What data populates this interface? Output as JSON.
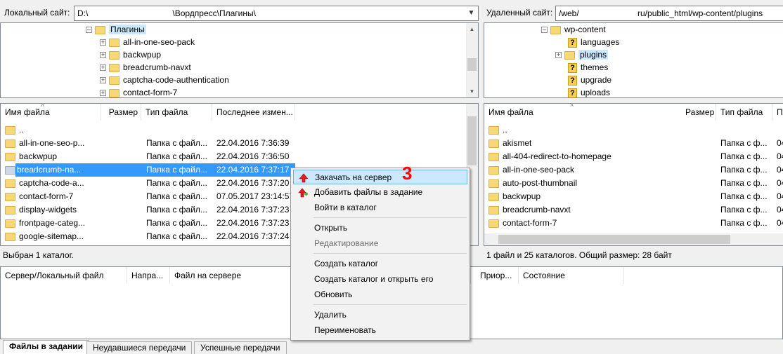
{
  "local": {
    "label": "Локальный сайт:",
    "path": "D:\\                                    \\Вордпресс\\Плагины\\",
    "tree": [
      {
        "label": "Плагины",
        "selected": true
      },
      {
        "label": "all-in-one-seo-pack"
      },
      {
        "label": "backwpup"
      },
      {
        "label": "breadcrumb-navxt"
      },
      {
        "label": "captcha-code-authentication"
      },
      {
        "label": "contact-form-7"
      }
    ],
    "columns": {
      "name": "Имя файла",
      "size": "Размер",
      "type": "Тип файла",
      "modified": "Последнее измен..."
    },
    "rows": [
      {
        "name": "..",
        "type": "",
        "date": ""
      },
      {
        "name": "all-in-one-seo-p...",
        "type": "Папка с файл...",
        "date": "22.04.2016 7:36:39"
      },
      {
        "name": "backwpup",
        "type": "Папка с файл...",
        "date": "22.04.2016 7:36:50"
      },
      {
        "name": "breadcrumb-na...",
        "type": "Папка с файл...",
        "date": "22.04.2016 7:37:17",
        "selected": true
      },
      {
        "name": "captcha-code-a...",
        "type": "Папка с файл...",
        "date": "22.04.2016 7:37:20"
      },
      {
        "name": "contact-form-7",
        "type": "Папка с файл...",
        "date": "07.05.2017 23:14:57"
      },
      {
        "name": "display-widgets",
        "type": "Папка с файл...",
        "date": "22.04.2016 7:37:23"
      },
      {
        "name": "frontpage-categ...",
        "type": "Папка с файл...",
        "date": "22.04.2016 7:37:23"
      },
      {
        "name": "google-sitemap...",
        "type": "Папка с файл...",
        "date": "22.04.2016 7:37:24"
      }
    ],
    "status": "Выбран 1 каталог."
  },
  "remote": {
    "label": "Удаленный сайт:",
    "path": "/web/                         ru/public_html/wp-content/plugins",
    "tree": [
      {
        "label": "wp-content",
        "icon": "folder"
      },
      {
        "label": "languages",
        "icon": "question"
      },
      {
        "label": "plugins",
        "icon": "folder",
        "highlight": true
      },
      {
        "label": "themes",
        "icon": "question"
      },
      {
        "label": "upgrade",
        "icon": "question"
      },
      {
        "label": "uploads",
        "icon": "question"
      }
    ],
    "columns": {
      "name": "Имя файла",
      "size": "Размер",
      "type": "Тип файла",
      "perm": "П"
    },
    "rows": [
      {
        "name": "..",
        "type": "",
        "perm": ""
      },
      {
        "name": "akismet",
        "type": "Папка с ф...",
        "perm": "04"
      },
      {
        "name": "all-404-redirect-to-homepage",
        "type": "Папка с ф...",
        "perm": "04"
      },
      {
        "name": "all-in-one-seo-pack",
        "type": "Папка с ф...",
        "perm": "04"
      },
      {
        "name": "auto-post-thumbnail",
        "type": "Папка с ф...",
        "perm": "04"
      },
      {
        "name": "backwpup",
        "type": "Папка с ф...",
        "perm": "04"
      },
      {
        "name": "breadcrumb-navxt",
        "type": "Папка с ф...",
        "perm": "04"
      },
      {
        "name": "contact-form-7",
        "type": "Папка с ф...",
        "perm": "04"
      }
    ],
    "status": "1 файл и 25 каталогов. Общий размер: 28 байт"
  },
  "queue": {
    "columns": {
      "server_local": "Сервер/Локальный файл",
      "direction": "Напра...",
      "remote_file": "Файл на сервере",
      "priority": "Приор...",
      "state": "Состояние"
    }
  },
  "tabs": [
    {
      "label": "Файлы в задании",
      "active": true
    },
    {
      "label": "Неудавшиеся передачи"
    },
    {
      "label": "Успешные передачи"
    }
  ],
  "context_menu": {
    "items": [
      {
        "label": "Закачать на сервер",
        "icon": "upload-arrow-icon",
        "hover": true
      },
      {
        "label": "Добавить файлы в задание",
        "icon": "add-to-queue-icon"
      },
      {
        "label": "Войти в каталог"
      },
      {
        "label": "Открыть"
      },
      {
        "label": "Редактирование",
        "disabled": true
      },
      {
        "label": "Создать каталог"
      },
      {
        "label": "Создать каталог и открыть его"
      },
      {
        "label": "Обновить"
      },
      {
        "label": "Удалить"
      },
      {
        "label": "Переименовать"
      }
    ],
    "annotation": "3"
  },
  "colors": {
    "selection": "#3399ff",
    "menu_hover": "#cce8ff",
    "folder": "#f8d775",
    "annotation": "#ff0000",
    "upload_arrow": "#e02020"
  }
}
